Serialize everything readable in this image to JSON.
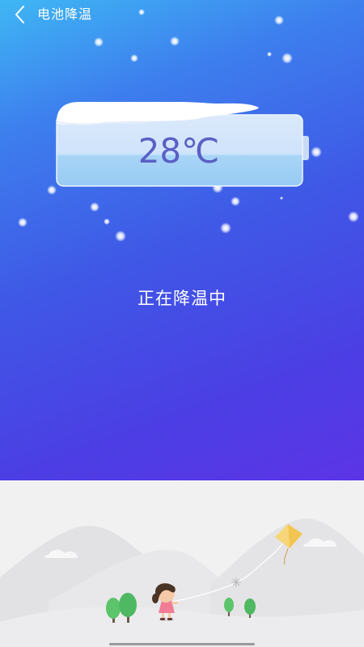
{
  "header": {
    "title": "电池降温",
    "back_icon": "chevron-left-icon"
  },
  "battery": {
    "temperature": "28℃",
    "icon": "battery-icon"
  },
  "status": {
    "text": "正在降温中"
  },
  "colors": {
    "gradient_top": "#3fb7f4",
    "gradient_bottom": "#5c34e6",
    "temperature_text": "#5a5fc4",
    "scene_background": "#f1f1f2",
    "kite": "#f2c552"
  }
}
